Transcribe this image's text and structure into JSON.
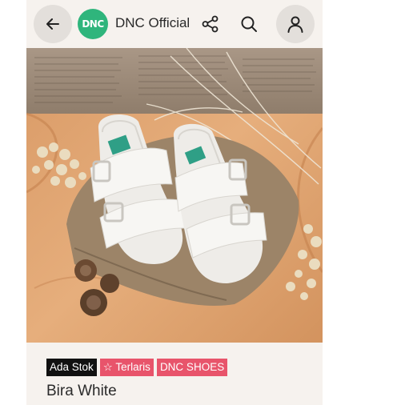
{
  "header": {
    "back_icon": "arrow-left-icon",
    "logo_text": "DNC",
    "store_name": "DNC Official",
    "share_icon": "share-icon",
    "search_icon": "search-icon",
    "profile_icon": "user-icon"
  },
  "product": {
    "image_alt": "product-photo-white-sandals",
    "badges": {
      "stock": "Ada Stok",
      "best_seller_icon": "star-outline-icon",
      "best_seller": "Terlaris",
      "brand": "DNC SHOES"
    },
    "title": "Bira White"
  },
  "colors": {
    "header_bg": "#f6f2ee",
    "logo_green": "#2fb57c",
    "badge_red": "#e8546b",
    "badge_black": "#111111"
  }
}
